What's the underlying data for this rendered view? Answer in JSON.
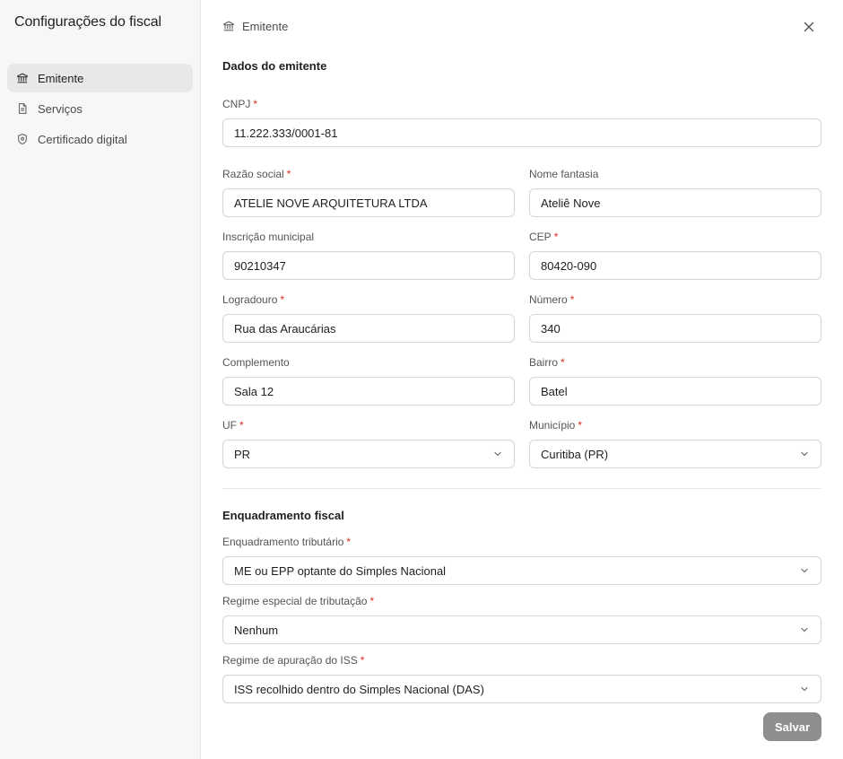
{
  "sidebar": {
    "title": "Configurações do fiscal",
    "items": [
      {
        "label": "Emitente",
        "icon": "bank-icon",
        "active": true
      },
      {
        "label": "Serviços",
        "icon": "document-icon",
        "active": false
      },
      {
        "label": "Certificado digital",
        "icon": "shield-icon",
        "active": false
      }
    ]
  },
  "header": {
    "breadcrumb": "Emitente",
    "breadcrumb_icon": "bank-icon",
    "close_icon": "close-icon"
  },
  "emitente": {
    "section_title": "Dados do emitente",
    "cnpj": {
      "label": "CNPJ",
      "value": "11.222.333/0001-81",
      "required": true
    },
    "razao_social": {
      "label": "Razão social",
      "value": "ATELIE NOVE ARQUITETURA LTDA",
      "required": true
    },
    "nome_fantasia": {
      "label": "Nome fantasia",
      "value": "Ateliê Nove",
      "required": false
    },
    "inscricao_municipal": {
      "label": "Inscrição municipal",
      "value": "90210347",
      "required": false
    },
    "cep": {
      "label": "CEP",
      "value": "80420-090",
      "required": true
    },
    "logradouro": {
      "label": "Logradouro",
      "value": "Rua das Araucárias",
      "required": true
    },
    "numero": {
      "label": "Número",
      "value": "340",
      "required": true
    },
    "complemento": {
      "label": "Complemento",
      "value": "Sala 12",
      "required": false
    },
    "bairro": {
      "label": "Bairro",
      "value": "Batel",
      "required": true
    },
    "uf": {
      "label": "UF",
      "value": "PR",
      "required": true
    },
    "municipio": {
      "label": "Município",
      "value": "Curitiba (PR)",
      "required": true
    }
  },
  "enquadramento": {
    "section_title": "Enquadramento fiscal",
    "tributario": {
      "label": "Enquadramento tributário",
      "value": "ME ou EPP optante do Simples Nacional",
      "required": true
    },
    "regime_especial": {
      "label": "Regime especial de tributação",
      "value": "Nenhum",
      "required": true
    },
    "regime_iss": {
      "label": "Regime de apuração do ISS",
      "value": "ISS recolhido dentro do Simples Nacional (DAS)",
      "required": true
    }
  },
  "actions": {
    "save_label": "Salvar"
  },
  "colors": {
    "required": "#d92d20",
    "save_button": "#8e8e8e",
    "active_nav": "#e8e8e8"
  }
}
